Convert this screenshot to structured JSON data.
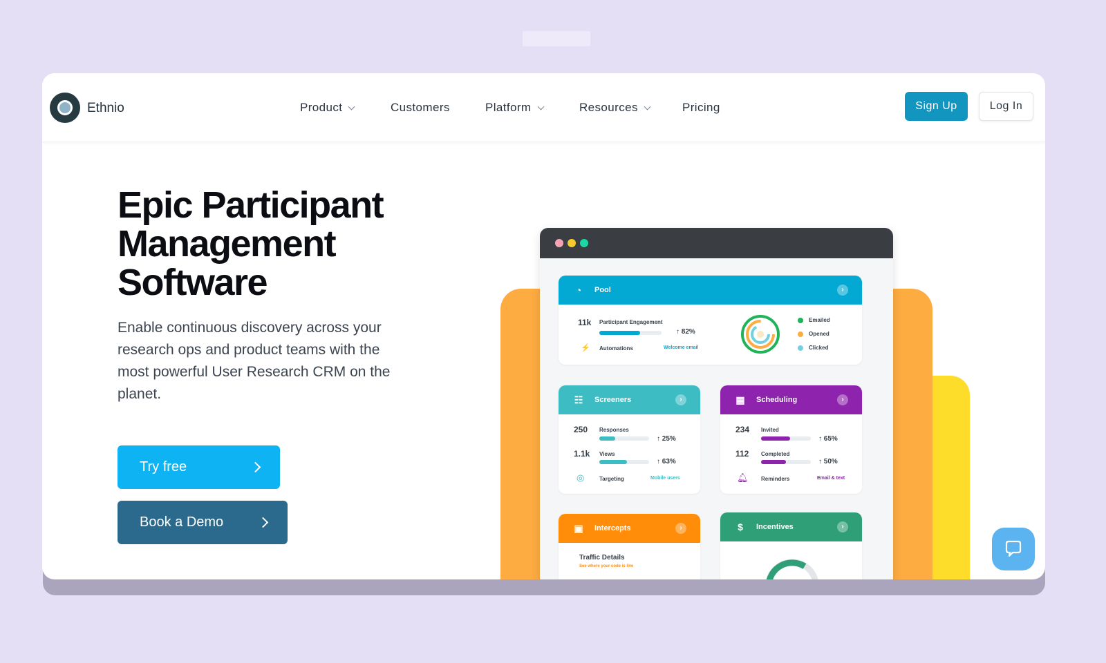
{
  "header": {
    "brand": "Ethnio",
    "nav": [
      "Product",
      "Customers",
      "Platform",
      "Resources",
      "Pricing"
    ],
    "sign_up": "Sign Up",
    "log_in": "Log In"
  },
  "hero": {
    "title": "Epic Participant Management Software",
    "subtitle": "Enable continuous discovery across your research ops and product teams with the most powerful User Research CRM on the planet.",
    "try_free": "Try free",
    "book_demo": "Book a Demo"
  },
  "dashboard": {
    "pool": {
      "title": "Pool",
      "count": "11k",
      "engagement_label": "Participant Engagement",
      "engagement_pct": "82%",
      "engagement_value": 0.66,
      "automations_label": "Automations",
      "automations_link": "Welcome email",
      "legend": [
        "Emailed",
        "Opened",
        "Clicked"
      ]
    },
    "screeners": {
      "title": "Screeners",
      "responses_count": "250",
      "responses_label": "Responses",
      "responses_pct": "25%",
      "responses_value": 0.32,
      "views_count": "1.1k",
      "views_label": "Views",
      "views_pct": "63%",
      "views_value": 0.56,
      "targeting_label": "Targeting",
      "targeting_link": "Mobile users"
    },
    "scheduling": {
      "title": "Scheduling",
      "invited_count": "234",
      "invited_label": "Invited",
      "invited_pct": "65%",
      "invited_value": 0.58,
      "completed_count": "112",
      "completed_label": "Completed",
      "completed_pct": "50%",
      "completed_value": 0.5,
      "reminders_label": "Reminders",
      "reminders_link": "Email & text"
    },
    "intercepts": {
      "title": "Intercepts",
      "traffic": "Traffic Details",
      "traffic_sub": "See where your code is live"
    },
    "incentives": {
      "title": "Incentives"
    }
  },
  "colors": {
    "pool": "#03a9d3",
    "screeners": "#3dbcc4",
    "scheduling": "#8e23ad",
    "intercepts": "#ff8d0a",
    "incentives": "#2f9f78",
    "orange_bg": "#fdac41",
    "yellow_bg": "#fddc2a"
  }
}
